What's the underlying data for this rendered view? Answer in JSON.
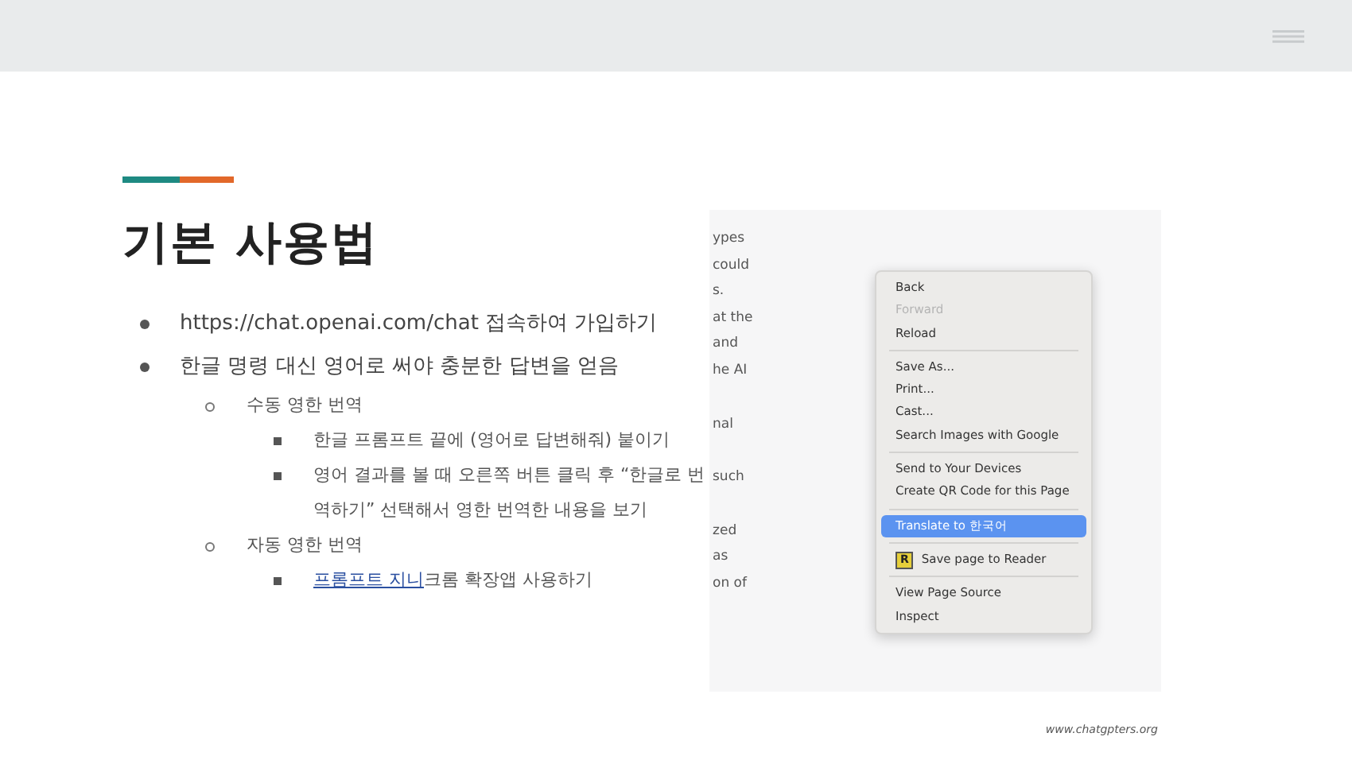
{
  "slide": {
    "title": "기본 사용법",
    "bullets": [
      {
        "text": "https://chat.openai.com/chat 접속하여 가입하기"
      },
      {
        "text": "한글 명령 대신 영어로 써야 충분한 답변을 얻음",
        "children": [
          {
            "text": "수동 영한 번역",
            "children": [
              {
                "text": "한글 프롬프트 끝에 (영어로 답변해줘) 붙이기"
              },
              {
                "text": "영어 결과를 볼 때 오른쪽 버튼 클릭 후 “한글로 번역하기” 선택해서 영한 번역한 내용을 보기"
              }
            ]
          },
          {
            "text": "자동 영한 번역",
            "children": [
              {
                "link": "프롬프트 지니",
                "text": "크롬 확장앱 사용하기"
              }
            ]
          }
        ]
      }
    ],
    "screenshot": {
      "page_text": [
        [
          "ypes",
          "could",
          "s.",
          "at the",
          "and",
          "he AI"
        ],
        [
          "nal"
        ],
        [
          "such"
        ],
        [
          "zed",
          "as",
          "on of"
        ]
      ],
      "context_menu": [
        {
          "kind": "item",
          "label": "Back",
          "disabled": false,
          "selected": false
        },
        {
          "kind": "item",
          "label": "Forward",
          "disabled": true,
          "selected": false
        },
        {
          "kind": "item",
          "label": "Reload",
          "disabled": false,
          "selected": false
        },
        {
          "kind": "separator"
        },
        {
          "kind": "item",
          "label": "Save As...",
          "disabled": false,
          "selected": false
        },
        {
          "kind": "item",
          "label": "Print...",
          "disabled": false,
          "selected": false
        },
        {
          "kind": "item",
          "label": "Cast...",
          "disabled": false,
          "selected": false
        },
        {
          "kind": "item",
          "label": "Search Images with Google",
          "disabled": false,
          "selected": false
        },
        {
          "kind": "separator"
        },
        {
          "kind": "item",
          "label": "Send to Your Devices",
          "disabled": false,
          "selected": false
        },
        {
          "kind": "item",
          "label": "Create QR Code for this Page",
          "disabled": false,
          "selected": false
        },
        {
          "kind": "separator"
        },
        {
          "kind": "item",
          "label": "Translate to 한국어",
          "disabled": false,
          "selected": true
        },
        {
          "kind": "separator"
        },
        {
          "kind": "badge-item",
          "badge": "R",
          "label": "Save page to Reader",
          "disabled": false,
          "selected": false
        },
        {
          "kind": "separator"
        },
        {
          "kind": "item",
          "label": "View Page Source",
          "disabled": false,
          "selected": false
        },
        {
          "kind": "item",
          "label": "Inspect",
          "disabled": false,
          "selected": false
        }
      ]
    },
    "footer": "www.chatgpters.org"
  }
}
